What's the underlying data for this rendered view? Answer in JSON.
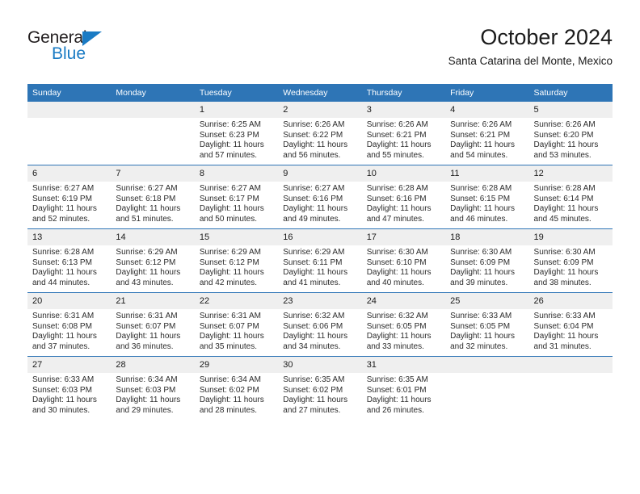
{
  "brand": {
    "name_top": "General",
    "name_bottom": "Blue",
    "triangle_color": "#1a7bc4",
    "text_color": "#231f20"
  },
  "header": {
    "title": "October 2024",
    "subtitle": "Santa Catarina del Monte, Mexico"
  },
  "theme": {
    "header_blue": "#2e75b6",
    "daynum_band": "#efefef",
    "divider": "#2e75b6"
  },
  "columns": [
    "Sunday",
    "Monday",
    "Tuesday",
    "Wednesday",
    "Thursday",
    "Friday",
    "Saturday"
  ],
  "weeks": [
    [
      {
        "day": "",
        "sunrise": "",
        "sunset": "",
        "daylight_line1": "",
        "daylight_line2": ""
      },
      {
        "day": "",
        "sunrise": "",
        "sunset": "",
        "daylight_line1": "",
        "daylight_line2": ""
      },
      {
        "day": "1",
        "sunrise": "Sunrise: 6:25 AM",
        "sunset": "Sunset: 6:23 PM",
        "daylight_line1": "Daylight: 11 hours",
        "daylight_line2": "and 57 minutes."
      },
      {
        "day": "2",
        "sunrise": "Sunrise: 6:26 AM",
        "sunset": "Sunset: 6:22 PM",
        "daylight_line1": "Daylight: 11 hours",
        "daylight_line2": "and 56 minutes."
      },
      {
        "day": "3",
        "sunrise": "Sunrise: 6:26 AM",
        "sunset": "Sunset: 6:21 PM",
        "daylight_line1": "Daylight: 11 hours",
        "daylight_line2": "and 55 minutes."
      },
      {
        "day": "4",
        "sunrise": "Sunrise: 6:26 AM",
        "sunset": "Sunset: 6:21 PM",
        "daylight_line1": "Daylight: 11 hours",
        "daylight_line2": "and 54 minutes."
      },
      {
        "day": "5",
        "sunrise": "Sunrise: 6:26 AM",
        "sunset": "Sunset: 6:20 PM",
        "daylight_line1": "Daylight: 11 hours",
        "daylight_line2": "and 53 minutes."
      }
    ],
    [
      {
        "day": "6",
        "sunrise": "Sunrise: 6:27 AM",
        "sunset": "Sunset: 6:19 PM",
        "daylight_line1": "Daylight: 11 hours",
        "daylight_line2": "and 52 minutes."
      },
      {
        "day": "7",
        "sunrise": "Sunrise: 6:27 AM",
        "sunset": "Sunset: 6:18 PM",
        "daylight_line1": "Daylight: 11 hours",
        "daylight_line2": "and 51 minutes."
      },
      {
        "day": "8",
        "sunrise": "Sunrise: 6:27 AM",
        "sunset": "Sunset: 6:17 PM",
        "daylight_line1": "Daylight: 11 hours",
        "daylight_line2": "and 50 minutes."
      },
      {
        "day": "9",
        "sunrise": "Sunrise: 6:27 AM",
        "sunset": "Sunset: 6:16 PM",
        "daylight_line1": "Daylight: 11 hours",
        "daylight_line2": "and 49 minutes."
      },
      {
        "day": "10",
        "sunrise": "Sunrise: 6:28 AM",
        "sunset": "Sunset: 6:16 PM",
        "daylight_line1": "Daylight: 11 hours",
        "daylight_line2": "and 47 minutes."
      },
      {
        "day": "11",
        "sunrise": "Sunrise: 6:28 AM",
        "sunset": "Sunset: 6:15 PM",
        "daylight_line1": "Daylight: 11 hours",
        "daylight_line2": "and 46 minutes."
      },
      {
        "day": "12",
        "sunrise": "Sunrise: 6:28 AM",
        "sunset": "Sunset: 6:14 PM",
        "daylight_line1": "Daylight: 11 hours",
        "daylight_line2": "and 45 minutes."
      }
    ],
    [
      {
        "day": "13",
        "sunrise": "Sunrise: 6:28 AM",
        "sunset": "Sunset: 6:13 PM",
        "daylight_line1": "Daylight: 11 hours",
        "daylight_line2": "and 44 minutes."
      },
      {
        "day": "14",
        "sunrise": "Sunrise: 6:29 AM",
        "sunset": "Sunset: 6:12 PM",
        "daylight_line1": "Daylight: 11 hours",
        "daylight_line2": "and 43 minutes."
      },
      {
        "day": "15",
        "sunrise": "Sunrise: 6:29 AM",
        "sunset": "Sunset: 6:12 PM",
        "daylight_line1": "Daylight: 11 hours",
        "daylight_line2": "and 42 minutes."
      },
      {
        "day": "16",
        "sunrise": "Sunrise: 6:29 AM",
        "sunset": "Sunset: 6:11 PM",
        "daylight_line1": "Daylight: 11 hours",
        "daylight_line2": "and 41 minutes."
      },
      {
        "day": "17",
        "sunrise": "Sunrise: 6:30 AM",
        "sunset": "Sunset: 6:10 PM",
        "daylight_line1": "Daylight: 11 hours",
        "daylight_line2": "and 40 minutes."
      },
      {
        "day": "18",
        "sunrise": "Sunrise: 6:30 AM",
        "sunset": "Sunset: 6:09 PM",
        "daylight_line1": "Daylight: 11 hours",
        "daylight_line2": "and 39 minutes."
      },
      {
        "day": "19",
        "sunrise": "Sunrise: 6:30 AM",
        "sunset": "Sunset: 6:09 PM",
        "daylight_line1": "Daylight: 11 hours",
        "daylight_line2": "and 38 minutes."
      }
    ],
    [
      {
        "day": "20",
        "sunrise": "Sunrise: 6:31 AM",
        "sunset": "Sunset: 6:08 PM",
        "daylight_line1": "Daylight: 11 hours",
        "daylight_line2": "and 37 minutes."
      },
      {
        "day": "21",
        "sunrise": "Sunrise: 6:31 AM",
        "sunset": "Sunset: 6:07 PM",
        "daylight_line1": "Daylight: 11 hours",
        "daylight_line2": "and 36 minutes."
      },
      {
        "day": "22",
        "sunrise": "Sunrise: 6:31 AM",
        "sunset": "Sunset: 6:07 PM",
        "daylight_line1": "Daylight: 11 hours",
        "daylight_line2": "and 35 minutes."
      },
      {
        "day": "23",
        "sunrise": "Sunrise: 6:32 AM",
        "sunset": "Sunset: 6:06 PM",
        "daylight_line1": "Daylight: 11 hours",
        "daylight_line2": "and 34 minutes."
      },
      {
        "day": "24",
        "sunrise": "Sunrise: 6:32 AM",
        "sunset": "Sunset: 6:05 PM",
        "daylight_line1": "Daylight: 11 hours",
        "daylight_line2": "and 33 minutes."
      },
      {
        "day": "25",
        "sunrise": "Sunrise: 6:33 AM",
        "sunset": "Sunset: 6:05 PM",
        "daylight_line1": "Daylight: 11 hours",
        "daylight_line2": "and 32 minutes."
      },
      {
        "day": "26",
        "sunrise": "Sunrise: 6:33 AM",
        "sunset": "Sunset: 6:04 PM",
        "daylight_line1": "Daylight: 11 hours",
        "daylight_line2": "and 31 minutes."
      }
    ],
    [
      {
        "day": "27",
        "sunrise": "Sunrise: 6:33 AM",
        "sunset": "Sunset: 6:03 PM",
        "daylight_line1": "Daylight: 11 hours",
        "daylight_line2": "and 30 minutes."
      },
      {
        "day": "28",
        "sunrise": "Sunrise: 6:34 AM",
        "sunset": "Sunset: 6:03 PM",
        "daylight_line1": "Daylight: 11 hours",
        "daylight_line2": "and 29 minutes."
      },
      {
        "day": "29",
        "sunrise": "Sunrise: 6:34 AM",
        "sunset": "Sunset: 6:02 PM",
        "daylight_line1": "Daylight: 11 hours",
        "daylight_line2": "and 28 minutes."
      },
      {
        "day": "30",
        "sunrise": "Sunrise: 6:35 AM",
        "sunset": "Sunset: 6:02 PM",
        "daylight_line1": "Daylight: 11 hours",
        "daylight_line2": "and 27 minutes."
      },
      {
        "day": "31",
        "sunrise": "Sunrise: 6:35 AM",
        "sunset": "Sunset: 6:01 PM",
        "daylight_line1": "Daylight: 11 hours",
        "daylight_line2": "and 26 minutes."
      },
      {
        "day": "",
        "sunrise": "",
        "sunset": "",
        "daylight_line1": "",
        "daylight_line2": ""
      },
      {
        "day": "",
        "sunrise": "",
        "sunset": "",
        "daylight_line1": "",
        "daylight_line2": ""
      }
    ]
  ]
}
